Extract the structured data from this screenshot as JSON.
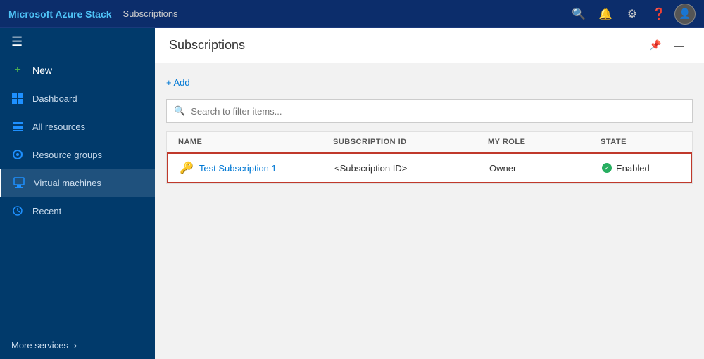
{
  "app": {
    "title": "Microsoft Azure Stack",
    "breadcrumb": "Subscriptions"
  },
  "topbar": {
    "icons": [
      "🔍",
      "🔔",
      "⚙",
      "?"
    ],
    "avatar_label": "👤"
  },
  "sidebar": {
    "hamburger": "☰",
    "items": [
      {
        "id": "new",
        "label": "New",
        "icon": "+",
        "icon_type": "plus"
      },
      {
        "id": "dashboard",
        "label": "Dashboard",
        "icon": "▦",
        "icon_type": "grid"
      },
      {
        "id": "all-resources",
        "label": "All resources",
        "icon": "⊞",
        "icon_type": "layers"
      },
      {
        "id": "resource-groups",
        "label": "Resource groups",
        "icon": "◉",
        "icon_type": "cube"
      },
      {
        "id": "virtual-machines",
        "label": "Virtual machines",
        "icon": "▣",
        "icon_type": "monitor",
        "active": true
      },
      {
        "id": "recent",
        "label": "Recent",
        "icon": "⏱",
        "icon_type": "clock"
      }
    ],
    "more_services_label": "More services",
    "more_services_arrow": "›"
  },
  "content": {
    "title": "Subscriptions",
    "pin_icon": "📌",
    "minimize_icon": "—",
    "add_button_label": "+ Add",
    "search_placeholder": "Search to filter items...",
    "table": {
      "columns": [
        {
          "label": "NAME"
        },
        {
          "label": "SUBSCRIPTION ID"
        },
        {
          "label": "MY ROLE"
        },
        {
          "label": "STATE"
        }
      ],
      "rows": [
        {
          "name": "Test Subscription 1",
          "subscription_id": "<Subscription ID>",
          "role": "Owner",
          "state": "Enabled"
        }
      ]
    }
  }
}
